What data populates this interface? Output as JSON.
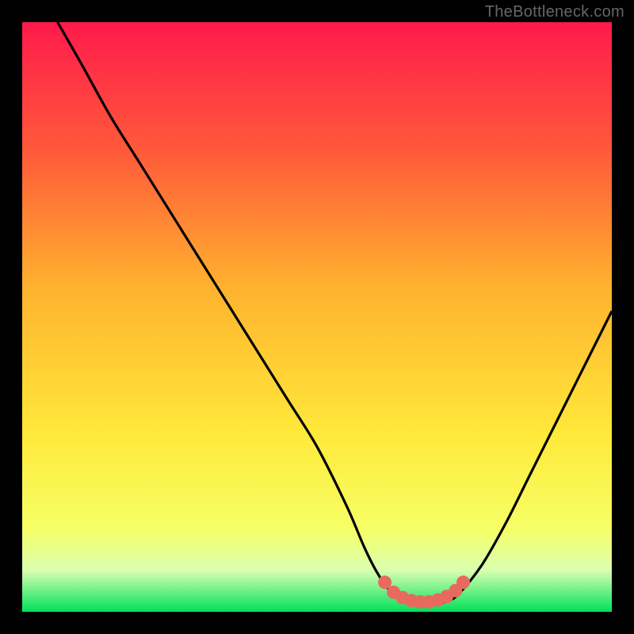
{
  "watermark": "TheBottleneck.com",
  "colors": {
    "bg_black": "#000000",
    "watermark_gray": "#666666",
    "curve": "#000000",
    "marker_fill": "#e86a5e",
    "marker_stroke": "#c9534a",
    "grad_top": "#ff1a4b",
    "grad_q1": "#ff5a3a",
    "grad_mid": "#ffb22e",
    "grad_q3": "#ffe93a",
    "grad_low": "#f6ff66",
    "grad_band": "#d9ffb0",
    "grad_bottom": "#00e05a"
  },
  "chart_data": {
    "type": "line",
    "title": "",
    "xlabel": "",
    "ylabel": "",
    "xlim": [
      0,
      100
    ],
    "ylim": [
      0,
      100
    ],
    "grid": false,
    "series": [
      {
        "name": "bottleneck-curve",
        "x": [
          6,
          10,
          15,
          20,
          25,
          30,
          35,
          40,
          45,
          50,
          55,
          58,
          60,
          62,
          64,
          66,
          68,
          70,
          72,
          74,
          78,
          82,
          86,
          90,
          94,
          98,
          100
        ],
        "y": [
          100,
          93,
          84,
          76,
          68,
          60,
          52,
          44,
          36,
          28,
          18,
          11,
          7,
          4,
          2.2,
          1.6,
          1.4,
          1.4,
          1.8,
          3,
          8,
          15,
          23,
          31,
          39,
          47,
          51
        ]
      }
    ],
    "markers": {
      "name": "highlight-range",
      "points": [
        {
          "x": 61.5,
          "y": 5.0
        },
        {
          "x": 63.0,
          "y": 3.3
        },
        {
          "x": 64.5,
          "y": 2.4
        },
        {
          "x": 66.0,
          "y": 1.9
        },
        {
          "x": 67.5,
          "y": 1.7
        },
        {
          "x": 69.0,
          "y": 1.7
        },
        {
          "x": 70.5,
          "y": 2.0
        },
        {
          "x": 72.0,
          "y": 2.6
        },
        {
          "x": 73.5,
          "y": 3.6
        },
        {
          "x": 74.8,
          "y": 5.0
        }
      ]
    },
    "background_gradient": {
      "type": "vertical",
      "stops": [
        {
          "pos": 0.0,
          "color": "#ff1a4b"
        },
        {
          "pos": 0.22,
          "color": "#ff5a3a"
        },
        {
          "pos": 0.45,
          "color": "#ffb22e"
        },
        {
          "pos": 0.7,
          "color": "#ffe93a"
        },
        {
          "pos": 0.86,
          "color": "#f6ff66"
        },
        {
          "pos": 0.93,
          "color": "#d9ffb0"
        },
        {
          "pos": 1.0,
          "color": "#00e05a"
        }
      ]
    }
  }
}
